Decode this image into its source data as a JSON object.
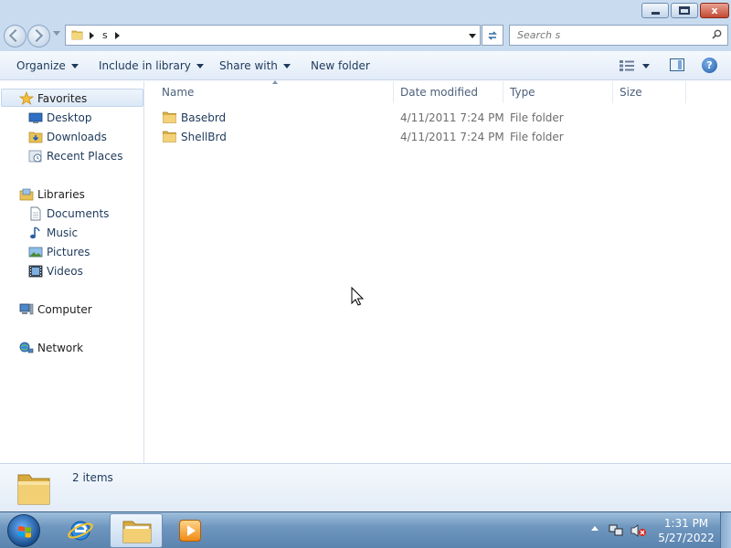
{
  "window": {
    "controls": {
      "close_glyph": "x"
    }
  },
  "address_bar": {
    "breadcrumb": [
      "s"
    ],
    "search_placeholder": "Search s"
  },
  "toolbar": {
    "organize": "Organize",
    "include_in_library": "Include in library",
    "share_with": "Share with",
    "new_folder": "New folder",
    "help_glyph": "?"
  },
  "nav": {
    "favorites": {
      "label": "Favorites",
      "items": [
        {
          "label": "Desktop"
        },
        {
          "label": "Downloads"
        },
        {
          "label": "Recent Places"
        }
      ]
    },
    "libraries": {
      "label": "Libraries",
      "items": [
        {
          "label": "Documents"
        },
        {
          "label": "Music"
        },
        {
          "label": "Pictures"
        },
        {
          "label": "Videos"
        }
      ]
    },
    "computer": {
      "label": "Computer"
    },
    "network": {
      "label": "Network"
    }
  },
  "file_list": {
    "columns": [
      "Name",
      "Date modified",
      "Type",
      "Size"
    ],
    "rows": [
      {
        "name": "Basebrd",
        "date_modified": "4/11/2011 7:24 PM",
        "type": "File folder",
        "size": ""
      },
      {
        "name": "ShellBrd",
        "date_modified": "4/11/2011 7:24 PM",
        "type": "File folder",
        "size": ""
      }
    ]
  },
  "details_pane": {
    "item_count": "2 items"
  },
  "taskbar": {
    "pinned": [
      "start-orb",
      "internet-explorer-icon",
      "windows-explorer-icon",
      "media-player-icon"
    ],
    "active": "windows-explorer-icon",
    "clock": {
      "time": "1:31 PM",
      "date": "5/27/2022"
    }
  },
  "colors": {
    "title_bar": "#c9dcef",
    "link_text": "#1e395b",
    "taskbar": "#6f97bf"
  }
}
